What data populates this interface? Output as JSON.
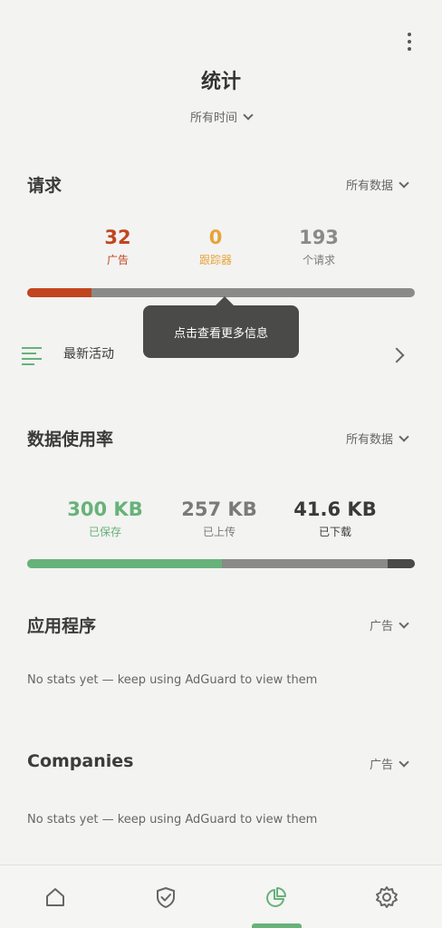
{
  "header": {
    "title": "统计",
    "period": "所有时间"
  },
  "requests": {
    "title": "请求",
    "filter": "所有数据",
    "stats": [
      {
        "value": "32",
        "label": "广告",
        "color": "#c1451f"
      },
      {
        "value": "0",
        "label": "跟踪器",
        "color": "#e8a33a"
      },
      {
        "value": "193",
        "label": "个请求",
        "color": "#8a8a88"
      }
    ],
    "bar_fraction_ads": 0.166,
    "tooltip": "点击查看更多信息",
    "recent_activity": "最新活动"
  },
  "data_usage": {
    "title": "数据使用率",
    "filter": "所有数据",
    "stats": [
      {
        "value": "300 KB",
        "label": "已保存",
        "color": "#67b279"
      },
      {
        "value": "257 KB",
        "label": "已上传",
        "color": "#7a7a78"
      },
      {
        "value": "41.6 KB",
        "label": "已下载",
        "color": "#3a3a3a"
      }
    ]
  },
  "apps": {
    "title": "应用程序",
    "filter": "广告",
    "empty": "No stats yet — keep using AdGuard to view them"
  },
  "companies": {
    "title": "Companies",
    "filter": "广告",
    "empty": "No stats yet — keep using AdGuard to view them"
  },
  "nav": {
    "items": [
      {
        "icon": "home-icon"
      },
      {
        "icon": "shield-check-icon"
      },
      {
        "icon": "pie-chart-icon",
        "active": true
      },
      {
        "icon": "gear-icon"
      }
    ],
    "accent": "#67b279"
  }
}
